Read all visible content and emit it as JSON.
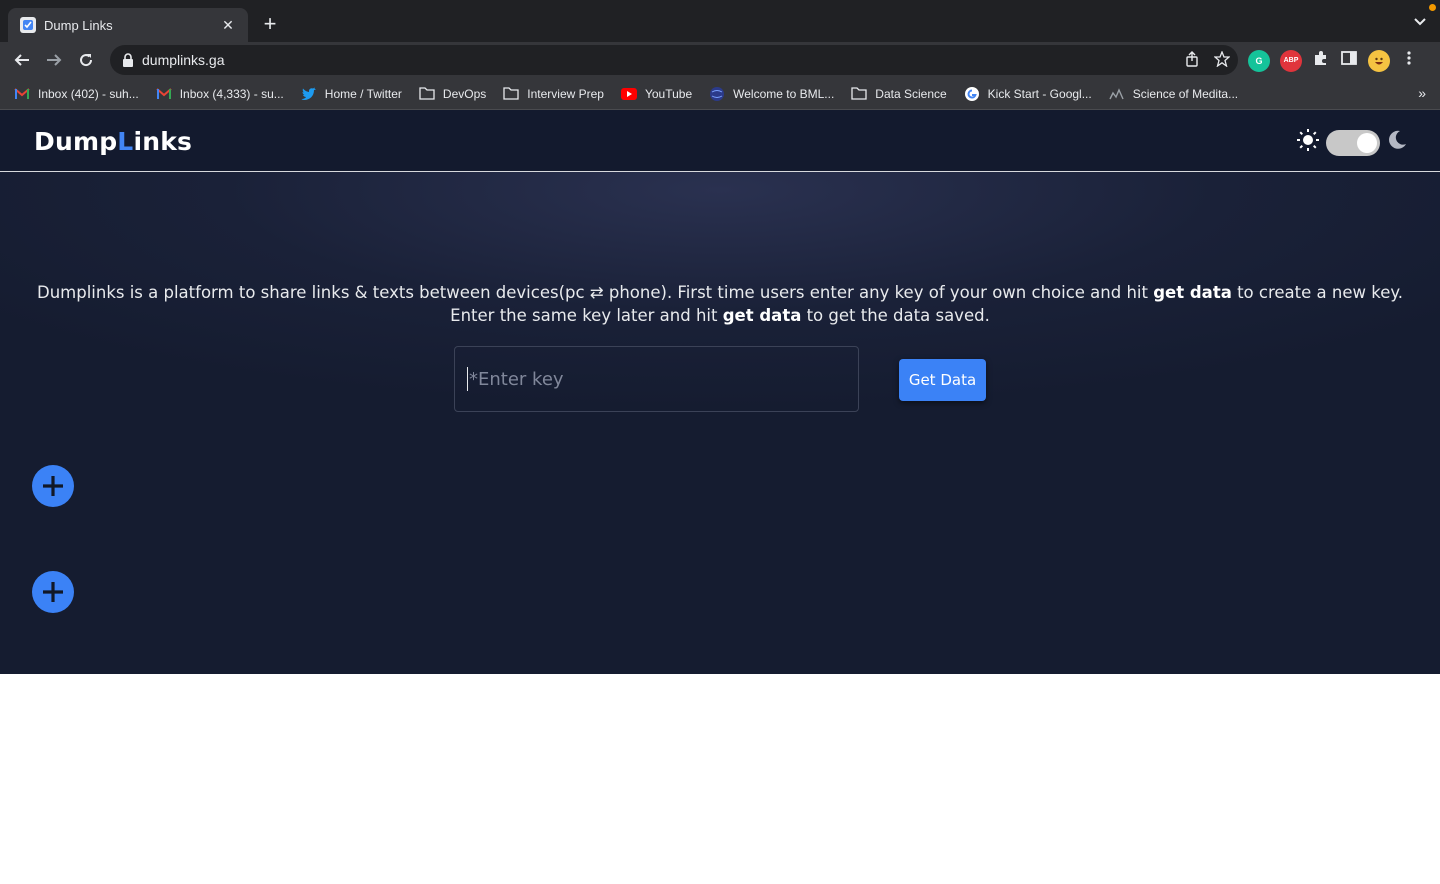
{
  "browser": {
    "tab_title": "Dump Links",
    "url": "dumplinks.ga",
    "bookmarks": [
      {
        "label": "Inbox (402) - suh...",
        "icon": "gmail-icon"
      },
      {
        "label": "Inbox (4,333) - su...",
        "icon": "gmail-icon"
      },
      {
        "label": "Home / Twitter",
        "icon": "twitter-icon"
      },
      {
        "label": "DevOps",
        "icon": "folder-icon"
      },
      {
        "label": "Interview Prep",
        "icon": "folder-icon"
      },
      {
        "label": "YouTube",
        "icon": "youtube-icon"
      },
      {
        "label": "Welcome to BML...",
        "icon": "globe-icon"
      },
      {
        "label": "Data Science",
        "icon": "folder-icon"
      },
      {
        "label": "Kick Start - Googl...",
        "icon": "google-icon"
      },
      {
        "label": "Science of Medita...",
        "icon": "chart-icon"
      }
    ],
    "extensions": [
      {
        "label": "G",
        "color": "#15c39a"
      },
      {
        "label": "ABP",
        "color": "#e0343c"
      }
    ]
  },
  "app": {
    "logo_part1": "Dump",
    "logo_accent": "L",
    "logo_part2": "inks",
    "accent_color": "#4285f4",
    "intro_prefix": "Dumplinks is a platform to share links & texts between devices(pc ⇄ phone). First time users enter any key of your own choice and hit ",
    "intro_bold1": "get data",
    "intro_middle": " to create a new key. Enter the same key later and hit ",
    "intro_bold2": "get data",
    "intro_suffix": " to get the data saved.",
    "key_placeholder": "*Enter key",
    "get_data_label": "Get Data",
    "button_color": "#3b82f6",
    "theme_toggle": "dark"
  }
}
